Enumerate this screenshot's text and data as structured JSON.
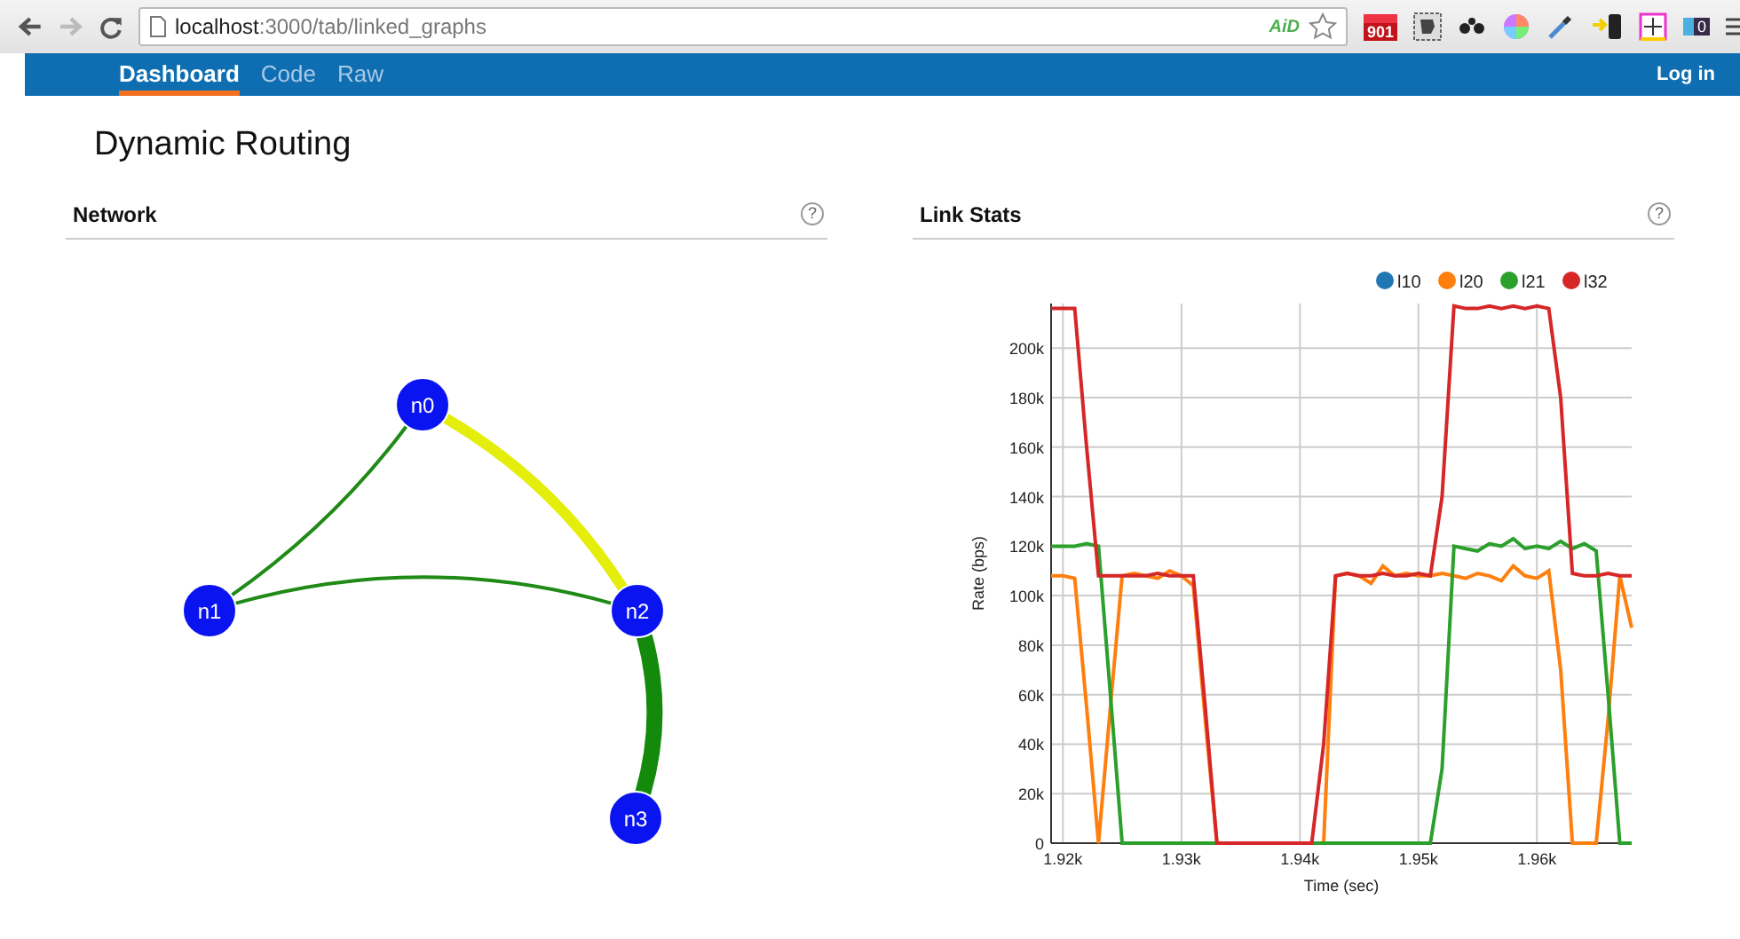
{
  "browser": {
    "url": "**localhost**:3000/tab/linked_graphs",
    "ad_badge": "AiD",
    "extension_badge": "901",
    "ghost_badge": "0"
  },
  "nav": {
    "tabs": [
      {
        "label": "Dashboard",
        "selected": true
      },
      {
        "label": "Code",
        "selected": false
      },
      {
        "label": "Raw",
        "selected": false
      }
    ],
    "login": "Log in"
  },
  "page": {
    "title": "Dynamic Routing"
  },
  "network": {
    "title": "Network",
    "help": "?",
    "nodes": [
      {
        "label": "n0"
      },
      {
        "label": "n1"
      },
      {
        "label": "n2"
      },
      {
        "label": "n3"
      }
    ],
    "edges": [
      {
        "color": "#1f8a16",
        "kind": "thin"
      },
      {
        "color": "#e4ee0a",
        "kind": "thick"
      },
      {
        "color": "#1f8a16",
        "kind": "thin"
      },
      {
        "color": "#138a0b",
        "kind": "heavy"
      }
    ]
  },
  "link_stats": {
    "title": "Link Stats",
    "help": "?",
    "chart_data": {
      "type": "line",
      "xlabel": "Time (sec)",
      "ylabel": "Rate (bps)",
      "x": [
        1919,
        1920,
        1921,
        1922,
        1923,
        1924,
        1925,
        1926,
        1927,
        1928,
        1929,
        1930,
        1931,
        1932,
        1933,
        1934,
        1935,
        1936,
        1937,
        1938,
        1939,
        1940,
        1941,
        1942,
        1943,
        1944,
        1945,
        1946,
        1947,
        1948,
        1949,
        1950,
        1951,
        1952,
        1953,
        1954,
        1955,
        1956,
        1957,
        1958,
        1959,
        1960,
        1961,
        1962,
        1963,
        1964,
        1965,
        1966,
        1967,
        1968
      ],
      "series": [
        {
          "name": "l10",
          "color": "#1f77b4",
          "values": [
            null,
            null,
            null,
            null,
            null,
            null,
            null,
            null,
            null,
            null,
            null,
            null,
            null,
            null,
            null,
            null,
            null,
            null,
            null,
            null,
            null,
            null,
            null,
            null,
            null,
            null,
            null,
            null,
            null,
            null,
            null,
            null,
            null,
            null,
            null,
            null,
            null,
            null,
            null,
            null,
            null,
            null,
            null,
            null,
            null,
            null,
            null,
            null,
            null,
            null
          ]
        },
        {
          "name": "l20",
          "color": "#ff7f0e",
          "values": [
            108,
            108,
            107,
            55,
            0,
            55,
            108,
            109,
            108,
            107,
            110,
            108,
            104,
            50,
            0,
            0,
            0,
            0,
            0,
            0,
            0,
            0,
            0,
            0,
            108,
            109,
            108,
            105,
            112,
            108,
            109,
            108,
            108,
            109,
            108,
            107,
            109,
            108,
            106,
            112,
            108,
            107,
            110,
            70,
            0,
            0,
            0,
            50,
            108,
            87
          ]
        },
        {
          "name": "l21",
          "color": "#2ca02c",
          "values": [
            120,
            120,
            120,
            121,
            120,
            60,
            0,
            0,
            0,
            0,
            0,
            0,
            0,
            0,
            0,
            0,
            0,
            0,
            0,
            0,
            0,
            0,
            0,
            0,
            0,
            0,
            0,
            0,
            0,
            0,
            0,
            0,
            0,
            30,
            120,
            119,
            118,
            121,
            120,
            123,
            119,
            120,
            119,
            122,
            119,
            121,
            118,
            60,
            0,
            0
          ]
        },
        {
          "name": "l32",
          "color": "#d62728",
          "values": [
            216,
            216,
            216,
            160,
            108,
            108,
            108,
            108,
            108,
            109,
            108,
            108,
            108,
            55,
            0,
            0,
            0,
            0,
            0,
            0,
            0,
            0,
            0,
            40,
            108,
            109,
            108,
            108,
            109,
            108,
            108,
            109,
            108,
            140,
            217,
            216,
            216,
            217,
            216,
            217,
            216,
            217,
            216,
            180,
            109,
            108,
            108,
            109,
            108,
            108
          ]
        }
      ],
      "xlim": [
        1919,
        1968
      ],
      "ylim": [
        0,
        218
      ],
      "grid": true,
      "legend": "top-right",
      "xticks": [
        {
          "value": 1920,
          "label": "1.92k"
        },
        {
          "value": 1930,
          "label": "1.93k"
        },
        {
          "value": 1940,
          "label": "1.94k"
        },
        {
          "value": 1950,
          "label": "1.95k"
        },
        {
          "value": 1960,
          "label": "1.96k"
        }
      ],
      "yticks": [
        {
          "value": 0,
          "label": "0"
        },
        {
          "value": 20,
          "label": "20k"
        },
        {
          "value": 40,
          "label": "40k"
        },
        {
          "value": 60,
          "label": "60k"
        },
        {
          "value": 80,
          "label": "80k"
        },
        {
          "value": 100,
          "label": "100k"
        },
        {
          "value": 120,
          "label": "120k"
        },
        {
          "value": 140,
          "label": "140k"
        },
        {
          "value": 160,
          "label": "160k"
        },
        {
          "value": 180,
          "label": "180k"
        },
        {
          "value": 200,
          "label": "200k"
        }
      ]
    }
  }
}
